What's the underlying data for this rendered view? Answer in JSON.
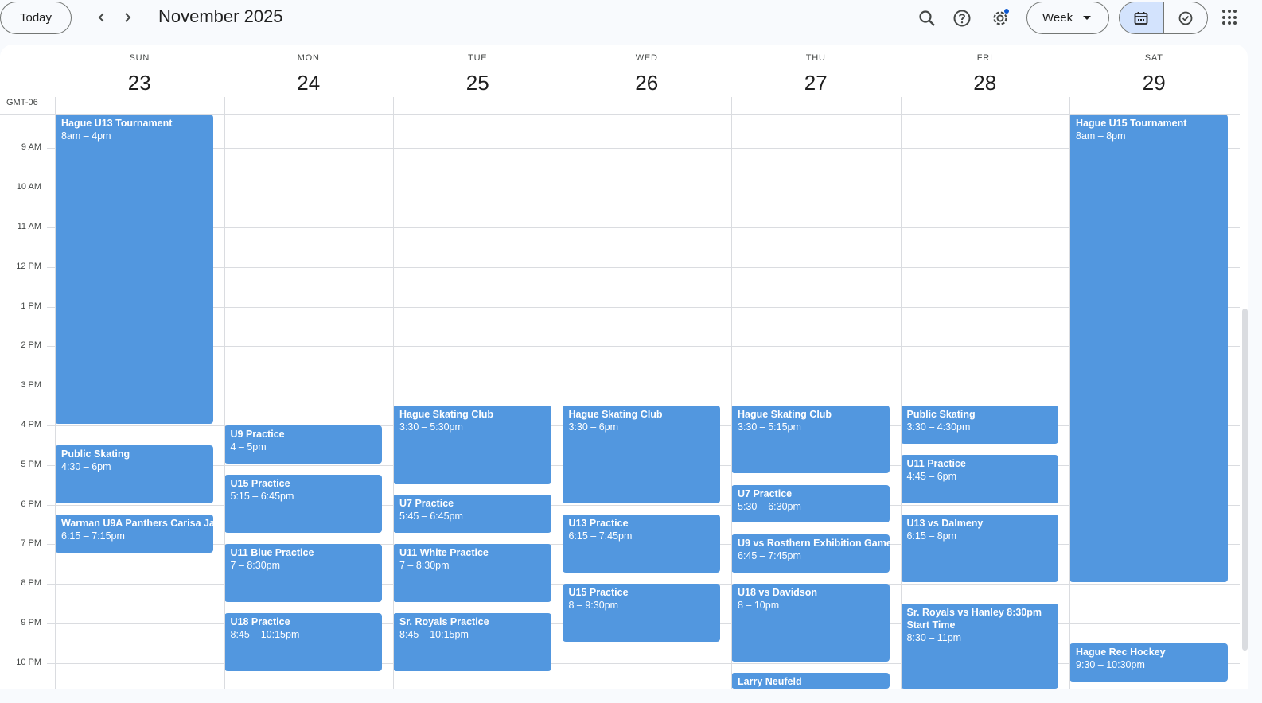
{
  "toolbar": {
    "today_label": "Today",
    "month_title": "November 2025",
    "view_label": "Week"
  },
  "timezone": "GMT-06",
  "days": [
    {
      "name": "SUN",
      "date": "23"
    },
    {
      "name": "MON",
      "date": "24"
    },
    {
      "name": "TUE",
      "date": "25"
    },
    {
      "name": "WED",
      "date": "26"
    },
    {
      "name": "THU",
      "date": "27"
    },
    {
      "name": "FRI",
      "date": "28"
    },
    {
      "name": "SAT",
      "date": "29"
    }
  ],
  "hours": [
    "9 AM",
    "10 AM",
    "11 AM",
    "12 PM",
    "1 PM",
    "2 PM",
    "3 PM",
    "4 PM",
    "5 PM",
    "6 PM",
    "7 PM",
    "8 PM",
    "9 PM",
    "10 PM"
  ],
  "events": [
    {
      "day": 0,
      "title": "Hague U13 Tournament",
      "time": "8am – 4pm",
      "start": 8,
      "end": 16
    },
    {
      "day": 0,
      "title": "Public Skating",
      "time": "4:30 – 6pm",
      "start": 16.5,
      "end": 18
    },
    {
      "day": 0,
      "title": "Warman U9A Panthers Carisa Ja",
      "time": "6:15 – 7:15pm",
      "start": 18.25,
      "end": 19.25
    },
    {
      "day": 1,
      "title": "U9 Practice",
      "time": "4 – 5pm",
      "start": 16,
      "end": 17
    },
    {
      "day": 1,
      "title": "U15 Practice",
      "time": "5:15 – 6:45pm",
      "start": 17.25,
      "end": 18.75
    },
    {
      "day": 1,
      "title": "U11 Blue Practice",
      "time": "7 – 8:30pm",
      "start": 19,
      "end": 20.5
    },
    {
      "day": 1,
      "title": "U18 Practice",
      "time": "8:45 – 10:15pm",
      "start": 20.75,
      "end": 22.25
    },
    {
      "day": 2,
      "title": "Hague Skating Club",
      "time": "3:30 – 5:30pm",
      "start": 15.5,
      "end": 17.5
    },
    {
      "day": 2,
      "title": "U7 Practice",
      "time": "5:45 – 6:45pm",
      "start": 17.75,
      "end": 18.75
    },
    {
      "day": 2,
      "title": "U11 White Practice",
      "time": "7 – 8:30pm",
      "start": 19,
      "end": 20.5
    },
    {
      "day": 2,
      "title": "Sr. Royals Practice",
      "time": "8:45 – 10:15pm",
      "start": 20.75,
      "end": 22.25
    },
    {
      "day": 3,
      "title": "Hague Skating Club",
      "time": "3:30 – 6pm",
      "start": 15.5,
      "end": 18
    },
    {
      "day": 3,
      "title": "U13 Practice",
      "time": "6:15 – 7:45pm",
      "start": 18.25,
      "end": 19.75
    },
    {
      "day": 3,
      "title": "U15 Practice",
      "time": "8 – 9:30pm",
      "start": 20,
      "end": 21.5
    },
    {
      "day": 4,
      "title": "Hague Skating Club",
      "time": "3:30 – 5:15pm",
      "start": 15.5,
      "end": 17.25
    },
    {
      "day": 4,
      "title": "U7 Practice",
      "time": "5:30 – 6:30pm",
      "start": 17.5,
      "end": 18.5
    },
    {
      "day": 4,
      "title": "U9 vs Rosthern Exhibition Game",
      "time": "6:45 – 7:45pm",
      "start": 18.75,
      "end": 19.75
    },
    {
      "day": 4,
      "title": "U18 vs Davidson",
      "time": "8 – 10pm",
      "start": 20,
      "end": 22
    },
    {
      "day": 4,
      "title": "Larry Neufeld",
      "time": "",
      "start": 22.25,
      "end": 23.5
    },
    {
      "day": 5,
      "title": "Public Skating",
      "time": "3:30 – 4:30pm",
      "start": 15.5,
      "end": 16.5
    },
    {
      "day": 5,
      "title": "U11 Practice",
      "time": "4:45 – 6pm",
      "start": 16.75,
      "end": 18
    },
    {
      "day": 5,
      "title": "U13 vs Dalmeny",
      "time": "6:15 – 8pm",
      "start": 18.25,
      "end": 20
    },
    {
      "day": 5,
      "title": "Sr. Royals vs Hanley 8:30pm Start Time",
      "time": "8:30 – 11pm",
      "start": 20.5,
      "end": 23
    },
    {
      "day": 6,
      "title": "Hague U15 Tournament",
      "time": "8am – 8pm",
      "start": 8,
      "end": 20
    },
    {
      "day": 6,
      "title": "Hague Rec Hockey",
      "time": "9:30 – 10:30pm",
      "start": 21.5,
      "end": 22.5
    }
  ],
  "colors": {
    "event": "#5297df",
    "accent_selected": "#d3e3fd",
    "notification_dot": "#0b57d0"
  },
  "icons": [
    "chevron-left-icon",
    "chevron-right-icon",
    "search-icon",
    "help-icon",
    "settings-icon",
    "calendar-icon",
    "task-check-icon",
    "apps-grid-icon"
  ]
}
